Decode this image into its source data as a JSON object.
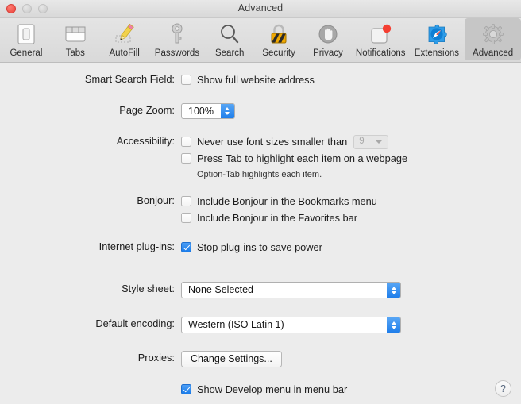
{
  "window": {
    "title": "Advanced",
    "traffic_lights": [
      {
        "name": "close",
        "color": "#f0524a",
        "active": true
      },
      {
        "name": "minimize",
        "color": "#d2d2d2",
        "active": false
      },
      {
        "name": "zoom",
        "color": "#d2d2d2",
        "active": false
      }
    ]
  },
  "toolbar": {
    "items": [
      {
        "label": "General",
        "icon": "general-icon",
        "selected": false
      },
      {
        "label": "Tabs",
        "icon": "tabs-icon",
        "selected": false
      },
      {
        "label": "AutoFill",
        "icon": "autofill-pencil-icon",
        "selected": false
      },
      {
        "label": "Passwords",
        "icon": "key-icon",
        "selected": false
      },
      {
        "label": "Search",
        "icon": "magnifier-icon",
        "selected": false
      },
      {
        "label": "Security",
        "icon": "padlock-icon",
        "selected": false
      },
      {
        "label": "Privacy",
        "icon": "hand-icon",
        "selected": false
      },
      {
        "label": "Notifications",
        "icon": "notification-badge-icon",
        "selected": false
      },
      {
        "label": "Extensions",
        "icon": "puzzle-compass-icon",
        "selected": false
      },
      {
        "label": "Advanced",
        "icon": "gear-icon",
        "selected": true
      }
    ]
  },
  "settings": {
    "smart_search_field": {
      "label": "Smart Search Field:",
      "checkbox_label": "Show full website address",
      "checked": false
    },
    "page_zoom": {
      "label": "Page Zoom:",
      "value": "100%"
    },
    "accessibility": {
      "label": "Accessibility:",
      "min_font": {
        "checkbox_label": "Never use font sizes smaller than",
        "checked": false,
        "size_value": "9",
        "size_enabled": false
      },
      "tab_highlight": {
        "checkbox_label": "Press Tab to highlight each item on a webpage",
        "checked": false
      },
      "hint": "Option-Tab highlights each item."
    },
    "bonjour": {
      "label": "Bonjour:",
      "options": [
        {
          "checkbox_label": "Include Bonjour in the Bookmarks menu",
          "checked": false
        },
        {
          "checkbox_label": "Include Bonjour in the Favorites bar",
          "checked": false
        }
      ]
    },
    "internet_plugins": {
      "label": "Internet plug-ins:",
      "checkbox_label": "Stop plug-ins to save power",
      "checked": true
    },
    "style_sheet": {
      "label": "Style sheet:",
      "value": "None Selected"
    },
    "default_encoding": {
      "label": "Default encoding:",
      "value": "Western (ISO Latin 1)"
    },
    "proxies": {
      "label": "Proxies:",
      "button_label": "Change Settings..."
    },
    "develop_menu": {
      "checkbox_label": "Show Develop menu in menu bar",
      "checked": true
    }
  },
  "help": {
    "glyph": "?"
  },
  "colors": {
    "window_background": "#ececec",
    "toolbar_background": "#dddddd",
    "selected_tab": "#c6c6c6",
    "accent_blue": "#1f7eea",
    "checkbox_checked": "#2a86ee",
    "close_red": "#f0524a",
    "disabled_text": "#a8a8a8"
  }
}
